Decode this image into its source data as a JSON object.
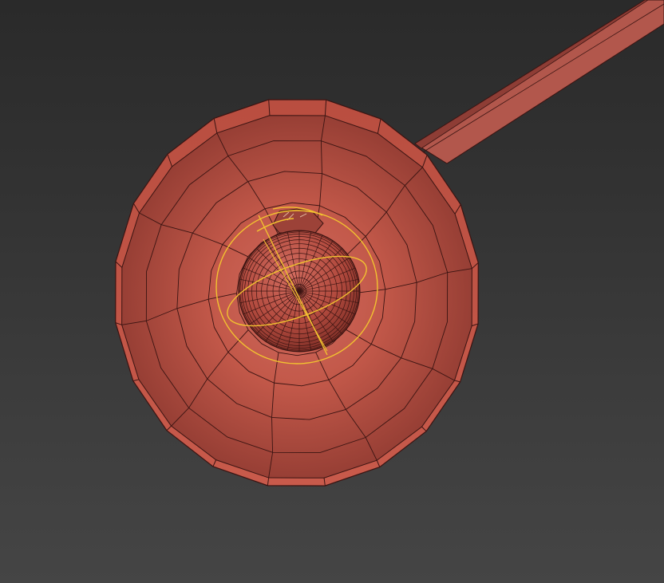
{
  "viewport": {
    "scene_colors": {
      "background_top": "#2a2a2a",
      "background_bottom": "#454545",
      "mesh_fill": "#c4584a",
      "mesh_fill_dark": "#8e3b32",
      "wire": "#3a1412",
      "selection": "#f2c230"
    },
    "objects": [
      {
        "name": "lamp-shade-dome",
        "selected": false
      },
      {
        "name": "lamp-arm",
        "selected": false
      },
      {
        "name": "bulb-sphere",
        "selected": true
      }
    ]
  }
}
